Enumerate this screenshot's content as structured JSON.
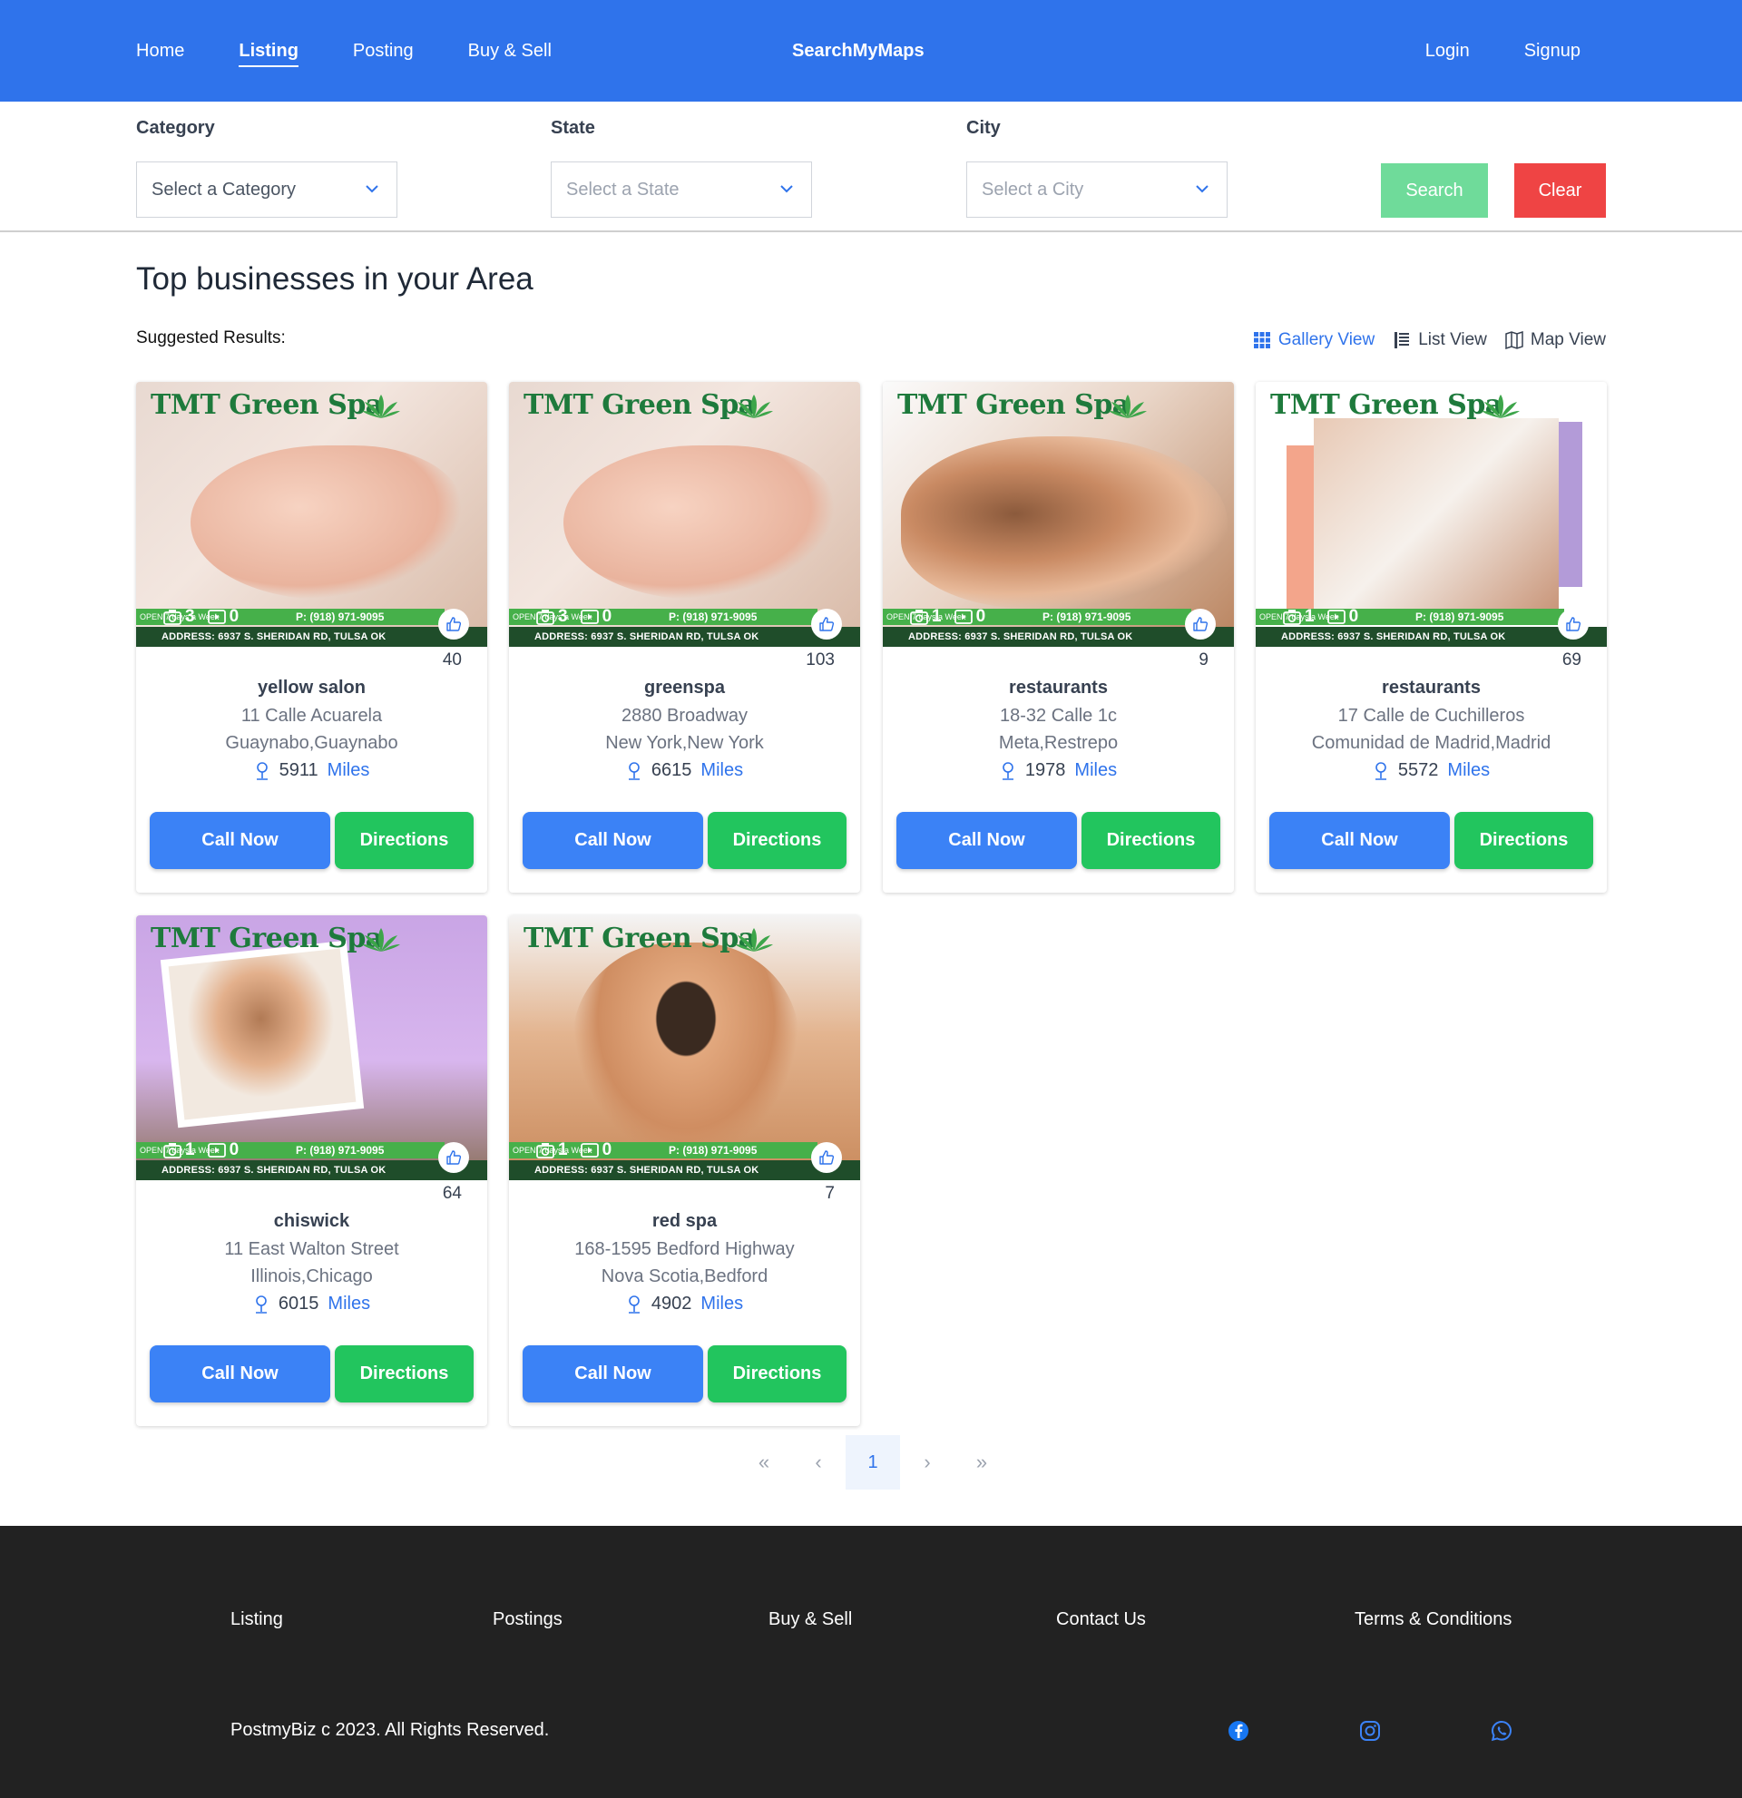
{
  "nav": {
    "links": [
      "Home",
      "Listing",
      "Posting",
      "Buy & Sell"
    ],
    "active": "Listing",
    "brand": "SearchMyMaps",
    "login": "Login",
    "signup": "Signup"
  },
  "filters": {
    "category": {
      "label": "Category",
      "placeholder": "Select a Category"
    },
    "state": {
      "label": "State",
      "placeholder": "Select a State"
    },
    "city": {
      "label": "City",
      "placeholder": "Select a City"
    },
    "search_label": "Search",
    "clear_label": "Clear"
  },
  "main": {
    "title": "Top businesses in your Area",
    "suggested": "Suggested Results:",
    "views": {
      "gallery": "Gallery View",
      "list": "List View",
      "map": "Map View"
    }
  },
  "card_common": {
    "spa_title": "TMT Green Spa",
    "phone": "P: (918) 971-9095",
    "address": "ADDRESS: 6937 S. SHERIDAN RD, TULSA OK",
    "open": "OPEN 7 days a Week",
    "call": "Call Now",
    "directions": "Directions",
    "miles": "Miles"
  },
  "cards": [
    {
      "name": "yellow salon",
      "address": "11 Calle Acuarela",
      "city": "Guaynabo,Guaynabo",
      "distance": "5911",
      "likes": "40",
      "photos": "3",
      "videos": "0"
    },
    {
      "name": "greenspa",
      "address": "2880 Broadway",
      "city": "New York,New York",
      "distance": "6615",
      "likes": "103",
      "photos": "3",
      "videos": "0"
    },
    {
      "name": "restaurants",
      "address": "18-32 Calle 1c",
      "city": "Meta,Restrepo",
      "distance": "1978",
      "likes": "9",
      "photos": "1",
      "videos": "0"
    },
    {
      "name": "restaurants",
      "address": "17 Calle de Cuchilleros",
      "city": "Comunidad de Madrid,Madrid",
      "distance": "5572",
      "likes": "69",
      "photos": "1",
      "videos": "0"
    },
    {
      "name": "chiswick",
      "address": "11 East Walton Street",
      "city": "Illinois,Chicago",
      "distance": "6015",
      "likes": "64",
      "photos": "1",
      "videos": "0"
    },
    {
      "name": "red spa",
      "address": "168-1595 Bedford Highway",
      "city": "Nova Scotia,Bedford",
      "distance": "4902",
      "likes": "7",
      "photos": "1",
      "videos": "0"
    }
  ],
  "pagination": {
    "first": "«",
    "prev": "‹",
    "current": "1",
    "next": "›",
    "last": "»"
  },
  "footer": {
    "links": [
      "Listing",
      "Postings",
      "Buy & Sell",
      "Contact Us",
      "Terms & Conditions"
    ],
    "copyright": "PostmyBiz c 2023. All Rights Reserved.",
    "socials": [
      "facebook-icon",
      "instagram-icon",
      "whatsapp-icon"
    ]
  },
  "colors": {
    "primary": "#2f73eb",
    "call": "#3b82f6",
    "directions": "#22c55e",
    "search": "#6fdb9a",
    "clear": "#ef4444",
    "footer": "#222222"
  }
}
